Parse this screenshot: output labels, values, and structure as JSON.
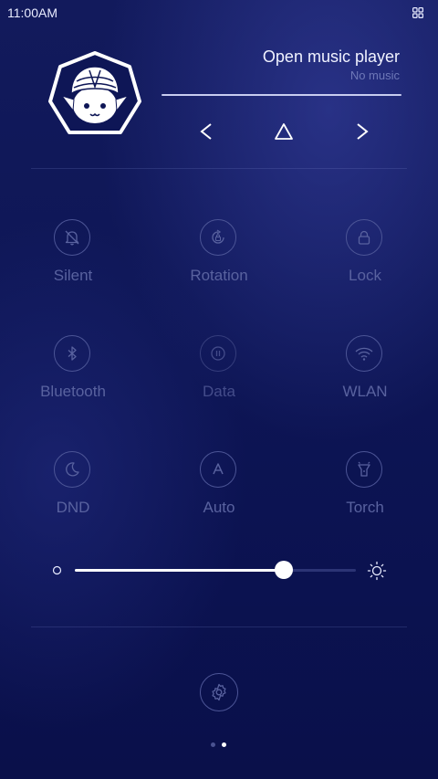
{
  "status_bar": {
    "time": "11:00AM",
    "right_icon": "grid-icon"
  },
  "music": {
    "title": "Open music player",
    "subtitle": "No music",
    "controls": {
      "previous_icon": "chevron-left-icon",
      "play_icon": "triangle-play-icon",
      "next_icon": "chevron-right-icon"
    }
  },
  "tiles": [
    {
      "label": "Silent",
      "icon": "bell-off-icon"
    },
    {
      "label": "Rotation",
      "icon": "rotation-lock-icon"
    },
    {
      "label": "Lock",
      "icon": "padlock-icon"
    },
    {
      "label": "Bluetooth",
      "icon": "bluetooth-icon"
    },
    {
      "label": "Data",
      "icon": "mobile-data-icon"
    },
    {
      "label": "WLAN",
      "icon": "wifi-icon"
    },
    {
      "label": "DND",
      "icon": "moon-icon"
    },
    {
      "label": "Auto",
      "icon": "auto-brightness-icon"
    },
    {
      "label": "Torch",
      "icon": "flashlight-icon"
    }
  ],
  "brightness": {
    "level_percent": 74.5,
    "min_icon": "dim-circle-icon",
    "max_icon": "sun-icon"
  },
  "bottom": {
    "settings_icon": "gear-icon",
    "pages_total": 2,
    "current_page": 2
  },
  "colors": {
    "background_top": "#121a5c",
    "background_bottom": "#0a104a",
    "tile_label": "#59629f",
    "accent": "#ffffff"
  }
}
